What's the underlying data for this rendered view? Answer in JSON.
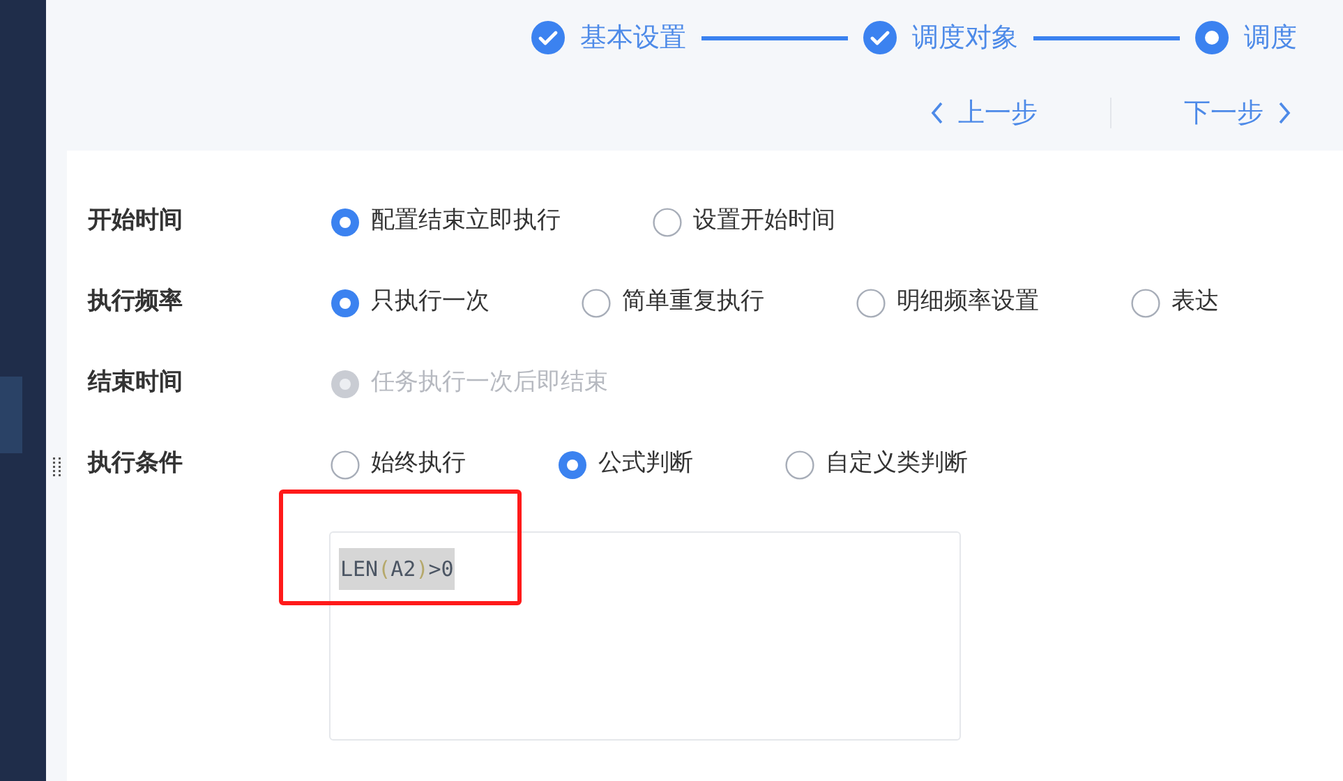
{
  "steps": [
    {
      "label": "基本设置",
      "completed": true
    },
    {
      "label": "调度对象",
      "completed": true
    },
    {
      "label": "调度",
      "completed": false
    }
  ],
  "nav": {
    "prev": "上一步",
    "next": "下一步"
  },
  "form": [
    {
      "label": "开始时间",
      "options": [
        {
          "text": "配置结束立即执行",
          "selected": true,
          "disabled": false
        },
        {
          "text": "设置开始时间",
          "selected": false,
          "disabled": false
        }
      ]
    },
    {
      "label": "执行频率",
      "options": [
        {
          "text": "只执行一次",
          "selected": true,
          "disabled": false
        },
        {
          "text": "简单重复执行",
          "selected": false,
          "disabled": false
        },
        {
          "text": "明细频率设置",
          "selected": false,
          "disabled": false
        },
        {
          "text": "表达",
          "selected": false,
          "disabled": false
        }
      ]
    },
    {
      "label": "结束时间",
      "options": [
        {
          "text": "任务执行一次后即结束",
          "selected": true,
          "disabled": true
        }
      ]
    },
    {
      "label": "执行条件",
      "options": [
        {
          "text": "始终执行",
          "selected": false,
          "disabled": false
        },
        {
          "text": "公式判断",
          "selected": true,
          "disabled": false
        },
        {
          "text": "自定义类判断",
          "selected": false,
          "disabled": false
        }
      ]
    }
  ],
  "formula": {
    "value": "LEN(A2)>0",
    "selected": true
  }
}
